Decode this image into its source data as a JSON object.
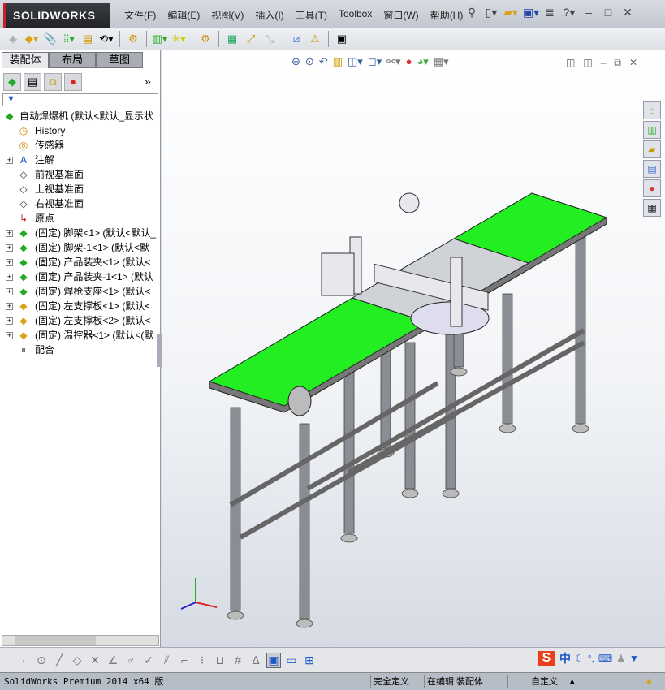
{
  "app": {
    "logo": "SOLIDWORKS"
  },
  "menu": [
    "文件(F)",
    "编辑(E)",
    "视图(V)",
    "插入(I)",
    "工具(T)",
    "Toolbox",
    "窗口(W)",
    "帮助(H)"
  ],
  "quick_access": [
    "pin-icon",
    "new-doc-icon",
    "open-icon",
    "save-icon",
    "options-icon",
    "help-icon"
  ],
  "window_controls": {
    "minimize": "–",
    "restore": "□",
    "close": "✕"
  },
  "toolbar": [
    "edit-component",
    "insert-components",
    "mate",
    "linear-pattern",
    "smart-fasteners",
    "move-component",
    "show-hidden",
    "assembly-features",
    "reference-geometry",
    "new-motion-study",
    "bill-of-materials",
    "exploded-view",
    "explode-line-sketch",
    "interference-detection",
    "instant3d"
  ],
  "panel": {
    "tabs": [
      "装配体",
      "布局",
      "草图"
    ],
    "more": "»",
    "filter": "▼",
    "tree": [
      {
        "label": "自动焊爆机  (默认<默认_显示状",
        "icon": "assembly",
        "expand": false,
        "indent": 0
      },
      {
        "label": "History",
        "icon": "history",
        "expand": false,
        "indent": 1
      },
      {
        "label": "传感器",
        "icon": "sensor",
        "expand": false,
        "indent": 1
      },
      {
        "label": "注解",
        "icon": "annotation",
        "expand": true,
        "indent": 1
      },
      {
        "label": "前视基准面",
        "icon": "plane",
        "expand": false,
        "indent": 1
      },
      {
        "label": "上视基准面",
        "icon": "plane",
        "expand": false,
        "indent": 1
      },
      {
        "label": "右视基准面",
        "icon": "plane",
        "expand": false,
        "indent": 1
      },
      {
        "label": "原点",
        "icon": "origin",
        "expand": false,
        "indent": 1
      },
      {
        "label": "(固定) 脚架<1> (默认<默认_",
        "icon": "subassembly",
        "expand": true,
        "indent": 1
      },
      {
        "label": "(固定) 脚架-1<1> (默认<默",
        "icon": "subassembly",
        "expand": true,
        "indent": 1
      },
      {
        "label": "(固定) 产品装夹<1> (默认<",
        "icon": "subassembly",
        "expand": true,
        "indent": 1
      },
      {
        "label": "(固定) 产品装夹-1<1> (默认",
        "icon": "subassembly",
        "expand": true,
        "indent": 1
      },
      {
        "label": "(固定) 焊枪支座<1> (默认<",
        "icon": "subassembly",
        "expand": true,
        "indent": 1
      },
      {
        "label": "(固定) 左支撑板<1> (默认<",
        "icon": "part",
        "expand": true,
        "indent": 1
      },
      {
        "label": "(固定) 左支撑板<2> (默认<",
        "icon": "part",
        "expand": true,
        "indent": 1
      },
      {
        "label": "(固定) 温控器<1> (默认<(默",
        "icon": "part",
        "expand": true,
        "indent": 1
      },
      {
        "label": "配合",
        "icon": "mates",
        "expand": false,
        "indent": 1
      }
    ]
  },
  "colors": {
    "belt": "#22ee22",
    "frame": "#8a8d94",
    "accent": "#c8202a"
  },
  "status": {
    "product": "SolidWorks Premium 2014 x64 版",
    "definition": "完全定义",
    "editing": "在编辑 装配体",
    "units": "自定义",
    "units_arrow": "▲"
  },
  "ime": {
    "lang": "中"
  }
}
